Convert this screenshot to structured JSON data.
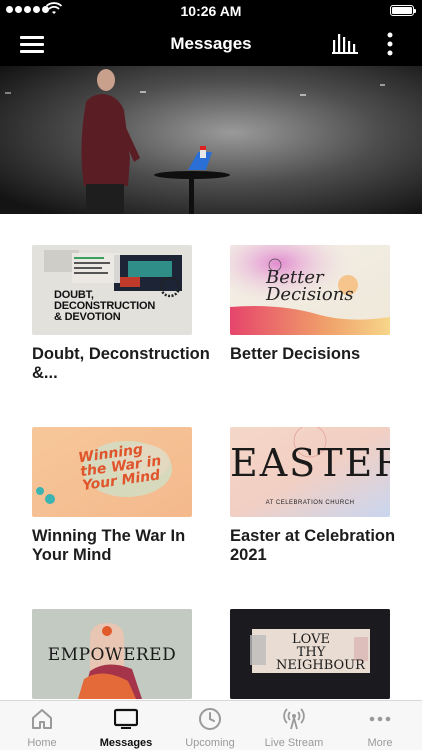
{
  "status_bar": {
    "time": "10:26 AM"
  },
  "nav": {
    "title": "Messages",
    "menu_icon": "hamburger-menu-icon",
    "bars_icon": "audio-bars-icon",
    "more_icon": "more-vertical-icon"
  },
  "hero": {
    "description_icon": "speaker-on-stage-image"
  },
  "series": [
    {
      "title": "Doubt, Deconstruction &...",
      "thumb_text": "DOUBT, DECONSTRUCTION & DEVOTION"
    },
    {
      "title": "Better Decisions",
      "thumb_text": "Better Decisions"
    },
    {
      "title": "Winning The War In Your Mind",
      "thumb_text": "Winning the War in Your Mind"
    },
    {
      "title": "Easter at Celebration 2021",
      "thumb_text": "EASTER",
      "thumb_subtext": "AT CELEBRATION CHURCH"
    },
    {
      "title": "",
      "thumb_text": "EMPOWERED"
    },
    {
      "title": "",
      "thumb_text": "LOVE THY NEIGHBOUR"
    }
  ],
  "tabs": [
    {
      "label": "Home",
      "icon": "home-icon"
    },
    {
      "label": "Messages",
      "icon": "tv-icon",
      "active": true
    },
    {
      "label": "Upcoming",
      "icon": "clock-icon"
    },
    {
      "label": "Live Stream",
      "icon": "broadcast-icon"
    },
    {
      "label": "More",
      "icon": "more-dots-icon"
    }
  ],
  "colors": {
    "bar_bg": "#000000",
    "tab_active": "#111111",
    "tab_inactive": "#9a9a9a"
  }
}
